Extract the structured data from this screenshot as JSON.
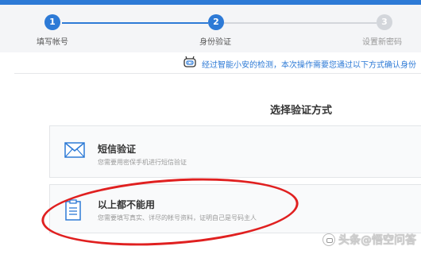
{
  "steps": [
    {
      "number": "1",
      "label": "填写帐号",
      "state": "active"
    },
    {
      "number": "2",
      "label": "身份验证",
      "state": "active"
    },
    {
      "number": "3",
      "label": "设置新密码",
      "state": "inactive"
    }
  ],
  "notice": {
    "icon": "robot-icon",
    "text": "经过智能小安的检测，本次操作需要您通过以下方式确认身份"
  },
  "section_title": "选择验证方式",
  "options": [
    {
      "icon": "envelope-icon",
      "title": "短信验证",
      "desc": "您需要用密保手机进行短信验证"
    },
    {
      "icon": "clipboard-icon",
      "title": "以上都不能用",
      "desc": "您需要填写真实、详尽的帐号资料，证明自己是号码主人"
    }
  ],
  "annotation": {
    "color": "#e02020"
  },
  "watermark": {
    "text": "头条@悟空问答"
  },
  "colors": {
    "accent": "#2d7ad6",
    "inactive": "#d3d6db"
  }
}
